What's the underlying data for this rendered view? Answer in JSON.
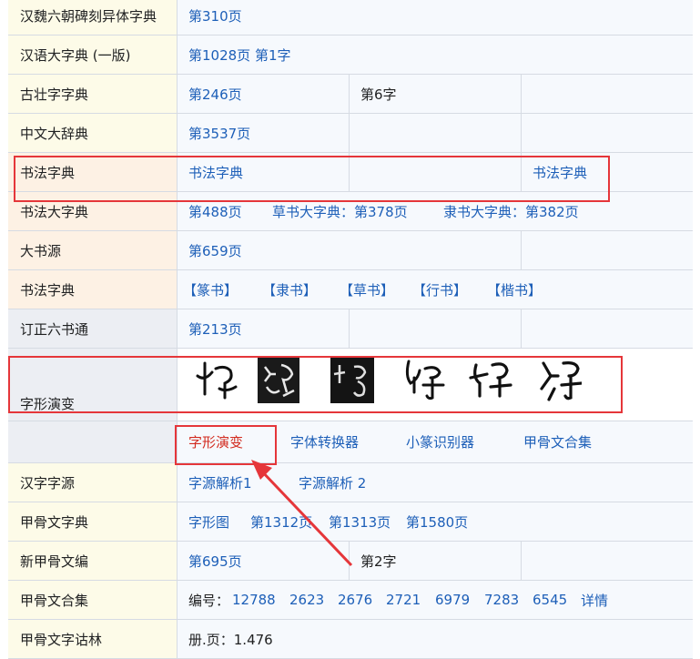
{
  "rows": {
    "r0": {
      "label": "汉魏六朝碑刻异体字典",
      "c1": "第310页"
    },
    "r1": {
      "label": "汉语大字典 (一版)",
      "c1": "第1028页 第1字"
    },
    "r2": {
      "label": "古壮字字典",
      "c1": "第246页",
      "c2": "第6字"
    },
    "r3": {
      "label": "中文大辞典",
      "c1": "第3537页"
    },
    "r4": {
      "label": "书法字典",
      "c1": "书法字典",
      "c3": "书法字典"
    },
    "r5": {
      "label": "书法大字典",
      "c1": "第488页",
      "c2": "草书大字典：第378页",
      "c3": "隶书大字典：第382页"
    },
    "r6": {
      "label": "大书源",
      "c1": "第659页"
    },
    "r7": {
      "label": "书法字典",
      "s1": "【篆书】",
      "s2": "【隶书】",
      "s3": "【草书】",
      "s4": "【行书】",
      "s5": "【楷书】"
    },
    "r8": {
      "label": "订正六书通",
      "c1": "第213页"
    },
    "r9": {
      "label": "字形演变",
      "glyphs": [
        "oracle-glyph-1",
        "oracle-glyph-2",
        "oracle-glyph-3",
        "oracle-glyph-4",
        "oracle-glyph-5",
        "oracle-glyph-6"
      ]
    },
    "r10": {
      "l1": "字形演变",
      "l2": "字体转换器",
      "l3": "小篆识别器",
      "l4": "甲骨文合集"
    },
    "r11": {
      "label": "汉字字源",
      "c1": "字源解析1",
      "c2": "字源解析 2"
    },
    "r12": {
      "label": "甲骨文字典",
      "c1": "字形图",
      "c2": "第1312页",
      "c3": "第1313页",
      "c4": "第1580页"
    },
    "r13": {
      "label": "新甲骨文编",
      "c1": "第695页",
      "c2": "第2字"
    },
    "r14": {
      "label": "甲骨文合集",
      "prefix": "编号：",
      "n1": "12788",
      "n2": "2623",
      "n3": "2676",
      "n4": "2721",
      "n5": "6979",
      "n6": "7283",
      "n7": "6545",
      "more": "详情"
    },
    "r15": {
      "label": "甲骨文字诂林",
      "c1": "册.页：1.476"
    }
  },
  "colors": {
    "link": "#1d5fb8",
    "highlight": "#e5363a",
    "active_link": "#d22b1f"
  }
}
